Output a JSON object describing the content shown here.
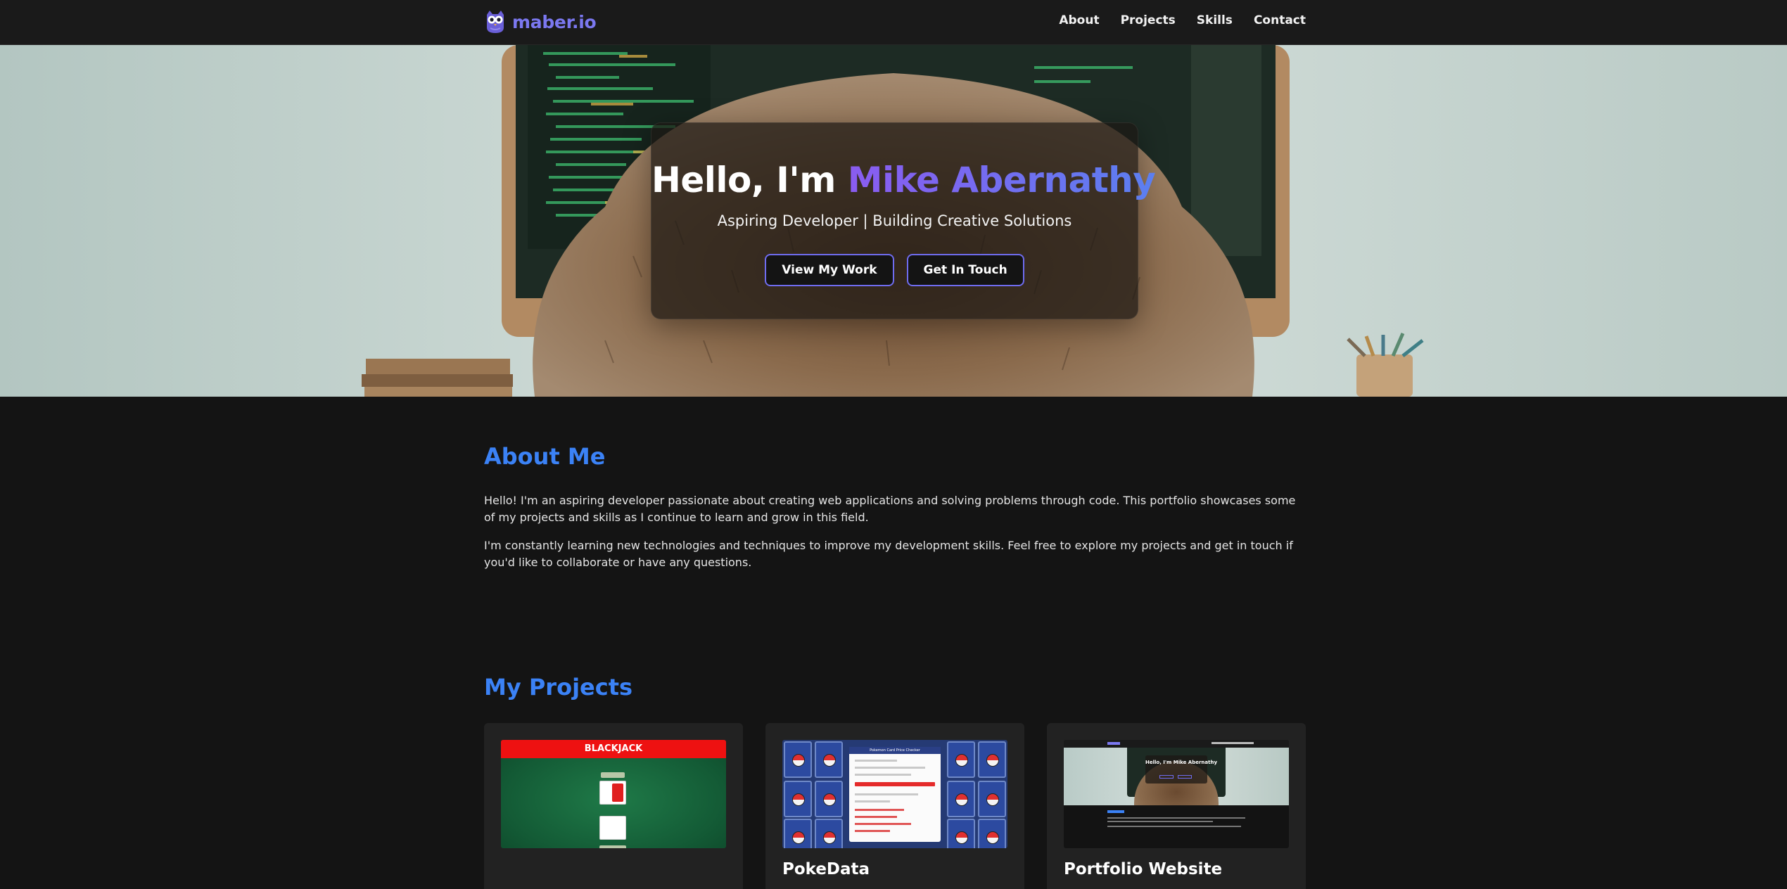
{
  "nav": {
    "brand": "maber.io",
    "links": [
      "About",
      "Projects",
      "Skills",
      "Contact"
    ]
  },
  "hero": {
    "greeting": "Hello, I'm ",
    "name": "Mike Abernathy",
    "subtitle": "Aspiring Developer | Building Creative Solutions",
    "primary_button": "View My Work",
    "secondary_button": "Get In Touch"
  },
  "about": {
    "title": "About Me",
    "paragraphs": [
      "Hello! I'm an aspiring developer passionate about creating web applications and solving problems through code. This portfolio showcases some of my projects and skills as I continue to learn and grow in this field.",
      "I'm constantly learning new technologies and techniques to improve my development skills. Feel free to explore my projects and get in touch if you'd like to collaborate or have any questions."
    ]
  },
  "projects": {
    "title": "My Projects",
    "items": [
      {
        "title": "",
        "thumb_label": "BLACKJACK"
      },
      {
        "title": "PokeData",
        "thumb_label": "Pokemon Card Price Checker"
      },
      {
        "title": "Portfolio Website",
        "thumb_label": "Hello, I'm Mike Abernathy"
      }
    ]
  },
  "colors": {
    "accent_blue": "#3b82f6",
    "brand_purple": "#7b78f0",
    "name_gradient_start": "#8a5cf0",
    "name_gradient_end": "#5b7ff0",
    "button_border": "#6f6cf0",
    "page_bg": "#141414"
  }
}
